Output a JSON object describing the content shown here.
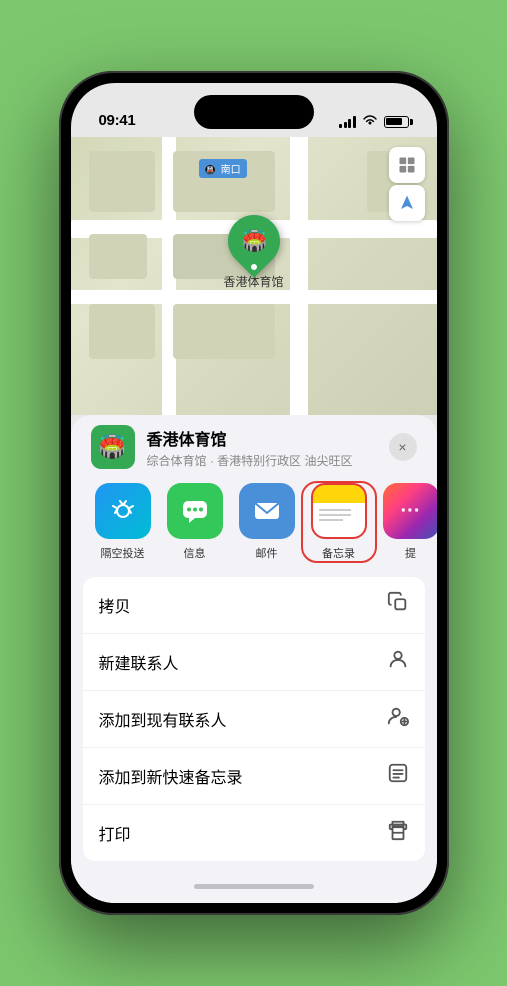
{
  "statusBar": {
    "time": "09:41",
    "location": true
  },
  "mapLabel": "南口",
  "venueName": "香港体育馆",
  "venueSub": "综合体育馆 · 香港特别行政区 油尖旺区",
  "shareApps": [
    {
      "id": "airdrop",
      "label": "隔空投送",
      "icon": "📡"
    },
    {
      "id": "messages",
      "label": "信息",
      "icon": "💬"
    },
    {
      "id": "mail",
      "label": "邮件",
      "icon": "✉️"
    },
    {
      "id": "notes",
      "label": "备忘录",
      "icon": "📝",
      "selected": true
    },
    {
      "id": "more",
      "label": "提",
      "icon": "•••"
    }
  ],
  "actions": [
    {
      "id": "copy",
      "label": "拷贝",
      "icon": "📋"
    },
    {
      "id": "new-contact",
      "label": "新建联系人",
      "icon": "👤"
    },
    {
      "id": "add-existing",
      "label": "添加到现有联系人",
      "icon": "👤+"
    },
    {
      "id": "add-quicknote",
      "label": "添加到新快速备忘录",
      "icon": "📊"
    },
    {
      "id": "print",
      "label": "打印",
      "icon": "🖨"
    }
  ],
  "pinLabel": "香港体育馆",
  "closeLabel": "×",
  "mapControlIcons": [
    "🗺️",
    "➤"
  ]
}
